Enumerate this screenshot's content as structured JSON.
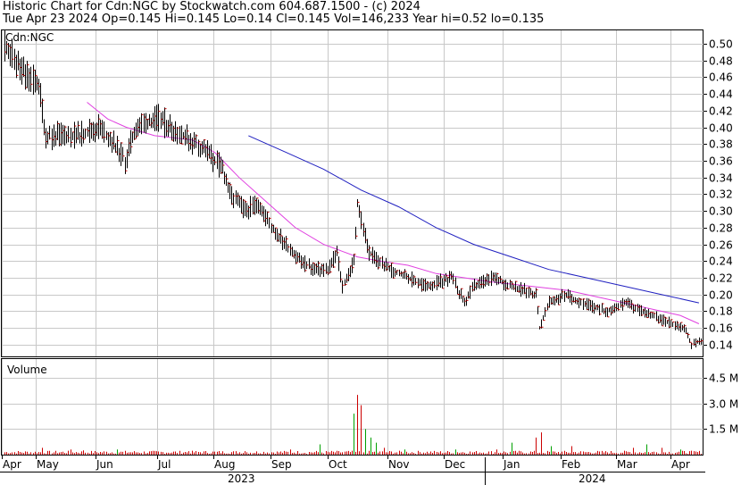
{
  "header": {
    "line1": "Historic Chart for Cdn:NGC by Stockwatch.com 604.687.1500 - (c) 2024",
    "line2": "Tue Apr 23 2024  Op=0.145  Hi=0.145  Lo=0.14  Cl=0.145  Vol=146,233  Year hi=0.52  lo=0.135"
  },
  "chart_data": [
    {
      "type": "ohlc",
      "symbol_label": "Cdn:NGC",
      "y_ticks": [
        "0.50",
        "0.48",
        "0.46",
        "0.44",
        "0.42",
        "0.40",
        "0.38",
        "0.36",
        "0.34",
        "0.32",
        "0.30",
        "0.28",
        "0.26",
        "0.24",
        "0.22",
        "0.20",
        "0.18",
        "0.16",
        "0.14"
      ],
      "ylim": [
        0.126,
        0.516
      ],
      "grid": true,
      "series": [
        {
          "name": "price",
          "color": "#000000",
          "keypoints": [
            [
              0,
              0.5
            ],
            [
              8,
              0.47
            ],
            [
              18,
              0.45
            ],
            [
              22,
              0.39
            ],
            [
              40,
              0.39
            ],
            [
              50,
              0.4
            ],
            [
              58,
              0.38
            ],
            [
              64,
              0.36
            ],
            [
              70,
              0.4
            ],
            [
              82,
              0.41
            ],
            [
              95,
              0.39
            ],
            [
              108,
              0.37
            ],
            [
              116,
              0.35
            ],
            [
              120,
              0.32
            ],
            [
              128,
              0.3
            ],
            [
              135,
              0.31
            ],
            [
              142,
              0.28
            ],
            [
              150,
              0.26
            ],
            [
              158,
              0.24
            ],
            [
              165,
              0.23
            ],
            [
              172,
              0.23
            ],
            [
              177,
              0.25
            ],
            [
              180,
              0.21
            ],
            [
              186,
              0.24
            ],
            [
              188,
              0.31
            ],
            [
              194,
              0.25
            ],
            [
              205,
              0.23
            ],
            [
              215,
              0.22
            ],
            [
              225,
              0.21
            ],
            [
              238,
              0.22
            ],
            [
              245,
              0.19
            ],
            [
              250,
              0.21
            ],
            [
              260,
              0.22
            ],
            [
              270,
              0.21
            ],
            [
              283,
              0.2
            ],
            [
              285,
              0.16
            ],
            [
              290,
              0.19
            ],
            [
              298,
              0.2
            ],
            [
              308,
              0.19
            ],
            [
              320,
              0.18
            ],
            [
              330,
              0.19
            ],
            [
              340,
              0.18
            ],
            [
              350,
              0.17
            ],
            [
              362,
              0.16
            ],
            [
              366,
              0.14
            ],
            [
              370,
              0.145
            ]
          ]
        }
      ],
      "moving_averages": [
        {
          "name": "ma-short",
          "color": "#e040e0",
          "points": [
            [
              44,
              0.43
            ],
            [
              55,
              0.41
            ],
            [
              65,
              0.4
            ],
            [
              80,
              0.39
            ],
            [
              100,
              0.385
            ],
            [
              112,
              0.37
            ],
            [
              125,
              0.34
            ],
            [
              140,
              0.31
            ],
            [
              155,
              0.28
            ],
            [
              170,
              0.26
            ],
            [
              188,
              0.245
            ],
            [
              200,
              0.24
            ],
            [
              215,
              0.235
            ],
            [
              230,
              0.225
            ],
            [
              245,
              0.22
            ],
            [
              260,
              0.215
            ],
            [
              280,
              0.21
            ],
            [
              300,
              0.205
            ],
            [
              320,
              0.195
            ],
            [
              340,
              0.185
            ],
            [
              360,
              0.175
            ],
            [
              370,
              0.165
            ]
          ]
        },
        {
          "name": "ma-long",
          "color": "#2020c0",
          "points": [
            [
              130,
              0.39
            ],
            [
              150,
              0.37
            ],
            [
              170,
              0.35
            ],
            [
              190,
              0.325
            ],
            [
              210,
              0.305
            ],
            [
              230,
              0.28
            ],
            [
              250,
              0.26
            ],
            [
              270,
              0.245
            ],
            [
              290,
              0.23
            ],
            [
              310,
              0.22
            ],
            [
              330,
              0.21
            ],
            [
              350,
              0.2
            ],
            [
              370,
              0.19
            ]
          ]
        }
      ]
    },
    {
      "type": "bar",
      "title": "Volume",
      "y_ticks": [
        "4.5 M",
        "3.0 M",
        "1.5 M"
      ],
      "ylim": [
        0,
        5.6
      ],
      "spikes": [
        [
          20,
          0.4
        ],
        [
          35,
          0.3
        ],
        [
          42,
          0.25
        ],
        [
          60,
          0.3
        ],
        [
          98,
          0.2
        ],
        [
          128,
          0.2
        ],
        [
          152,
          0.3
        ],
        [
          168,
          0.6
        ],
        [
          186,
          2.4
        ],
        [
          188,
          3.5
        ],
        [
          190,
          2.9
        ],
        [
          192,
          1.5
        ],
        [
          195,
          1.0
        ],
        [
          198,
          0.7
        ],
        [
          202,
          0.4
        ],
        [
          213,
          0.3
        ],
        [
          240,
          0.3
        ],
        [
          262,
          0.3
        ],
        [
          270,
          0.7
        ],
        [
          283,
          1.0
        ],
        [
          286,
          1.3
        ],
        [
          291,
          0.5
        ],
        [
          302,
          0.5
        ],
        [
          335,
          0.4
        ],
        [
          342,
          0.6
        ],
        [
          350,
          0.4
        ],
        [
          360,
          0.3
        ]
      ]
    }
  ],
  "months": [
    "Apr",
    "May",
    "Jun",
    "Jul",
    "Aug",
    "Sep",
    "Oct",
    "Nov",
    "Dec",
    "Jan",
    "Feb",
    "Mar",
    "Apr"
  ],
  "years": [
    "2023",
    "2024"
  ]
}
